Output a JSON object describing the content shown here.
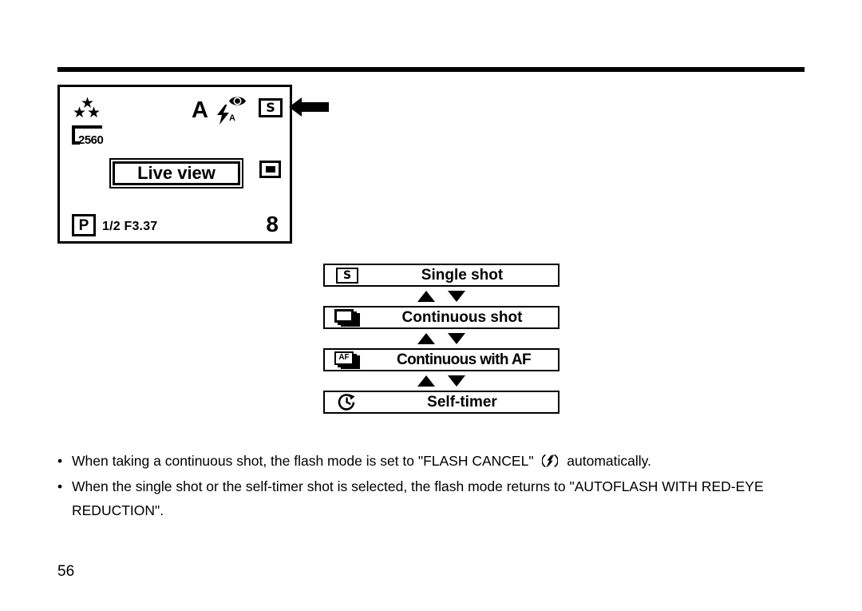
{
  "document": {
    "page_number": "56"
  },
  "lcd_display": {
    "quality_stars": [
      "star",
      "star",
      "star"
    ],
    "resolution": "2560",
    "exposure_mode": "A",
    "flash_mode_icon": "autoflash-red-eye-icon",
    "flash_mode_letter": "A",
    "drive_mode_indicator": "S",
    "live_view_label": "Live view",
    "metering_icon": "spot-metering-icon",
    "program_mode": "P",
    "exposure_values": "1/2 F3.37",
    "frames_remaining": "8",
    "pointer_icon": "left-arrow-icon"
  },
  "drive_menu": {
    "items": [
      {
        "icon": "single-shot-icon",
        "icon_label": "S",
        "label": "Single shot"
      },
      {
        "icon": "continuous-shot-icon",
        "icon_label": "",
        "label": "Continuous shot"
      },
      {
        "icon": "continuous-af-icon",
        "icon_label": "AF",
        "label": "Continuous with AF"
      },
      {
        "icon": "self-timer-icon",
        "icon_label": "",
        "label": "Self-timer"
      }
    ],
    "separator_up_icon": "triangle-up-icon",
    "separator_down_icon": "triangle-down-icon"
  },
  "notes": {
    "bullet_char": "•",
    "items": [
      {
        "text_before": "When taking a continuous shot, the flash mode is set to \"FLASH CANCEL\"",
        "inline_icon": "flash-cancel-icon",
        "text_after": "automatically."
      },
      {
        "text_before": "When the single shot or the self-timer shot is selected, the flash mode returns to \"AUTOFLASH WITH RED-EYE REDUCTION\".",
        "inline_icon": "",
        "text_after": ""
      }
    ]
  },
  "colors": {
    "ink": "#000000",
    "paper": "#ffffff"
  }
}
